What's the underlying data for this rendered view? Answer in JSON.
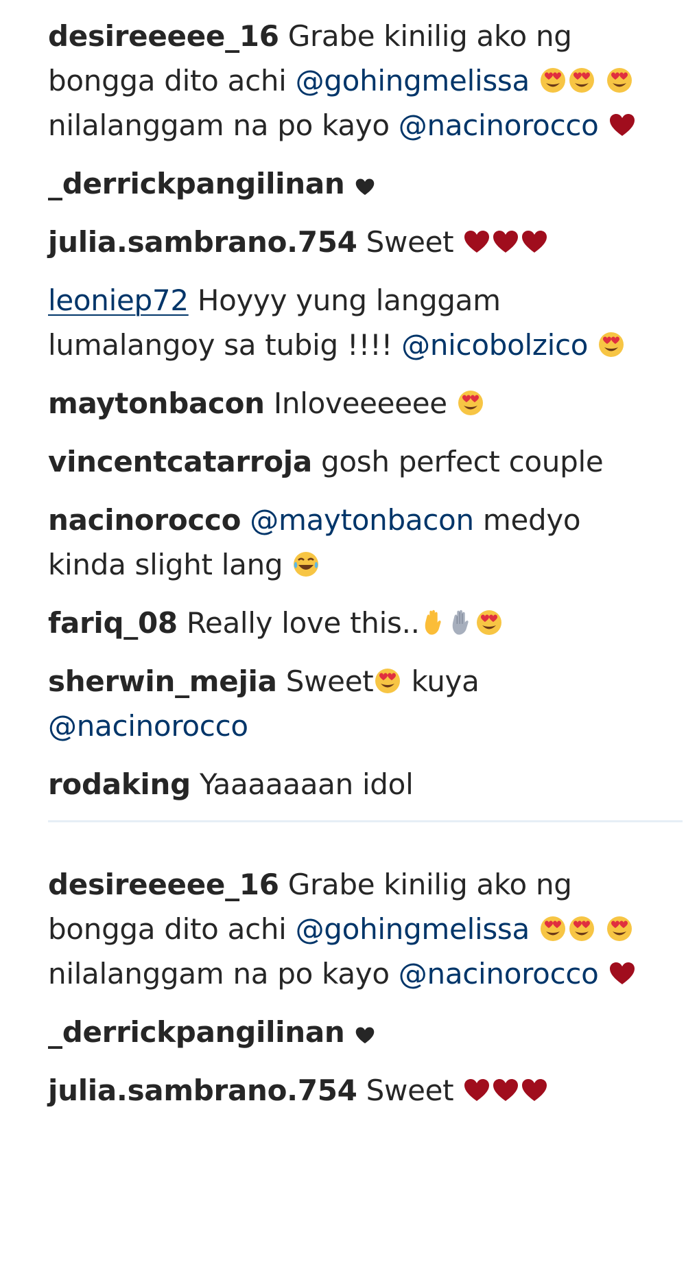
{
  "colors": {
    "username": "#262626",
    "text": "#262626",
    "mention": "#003569",
    "heart_red": "#a00d1d",
    "heart_black": "#262626",
    "emoji_face": "#f7c544",
    "emoji_heart_eyes": "#e02f3f",
    "divider": "#e6eef6"
  },
  "comments": [
    {
      "user": "desireeeee_16",
      "t1": "Grabe kinilig ako ng bongga dito achi",
      "m1": "@gohingmelissa",
      "t2": "nilalanggam na po kayo",
      "m2": "@nacinorocco",
      "emoji_names": [
        "heart-eyes-icon",
        "heart-eyes-icon",
        "heart-eyes-icon",
        "red-heart-icon"
      ]
    },
    {
      "user": "_derrickpangilinan",
      "emoji_names": [
        "black-heart-icon"
      ]
    },
    {
      "user": "julia.sambrano.754",
      "t1": "Sweet",
      "emoji_names": [
        "red-heart-icon",
        "red-heart-icon",
        "red-heart-icon"
      ]
    },
    {
      "user": "leoniep72",
      "t1": "Hoyyy yung langgam lumalangoy sa tubig !!!!",
      "m1": "@nicobolzico",
      "emoji_names": [
        "heart-eyes-icon"
      ]
    },
    {
      "user": "maytonbacon",
      "t1": "Inloveeeeee",
      "emoji_names": [
        "heart-eyes-icon"
      ]
    },
    {
      "user": "vincentcatarroja",
      "t1": "gosh perfect couple"
    },
    {
      "user": "nacinorocco",
      "m1": "@maytonbacon",
      "t1": "medyo kinda slight lang",
      "emoji_names": [
        "tears-of-joy-icon"
      ]
    },
    {
      "user": "fariq_08",
      "t1": "Really love this..",
      "emoji_names": [
        "raised-hand-icon",
        "grey-hand-icon",
        "heart-eyes-icon"
      ]
    },
    {
      "user": "sherwin_mejia",
      "t1": "Sweet",
      "t2": "kuya",
      "m1": "@nacinorocco",
      "emoji_names": [
        "heart-eyes-icon"
      ]
    },
    {
      "user": "rodaking",
      "t1": "Yaaaaaaan idol"
    },
    {
      "user": "desireeeee_16",
      "t1": "Grabe kinilig ako ng bongga dito achi",
      "m1": "@gohingmelissa",
      "t2": "nilalanggam na po kayo",
      "m2": "@nacinorocco",
      "emoji_names": [
        "heart-eyes-icon",
        "heart-eyes-icon",
        "heart-eyes-icon",
        "red-heart-icon"
      ]
    },
    {
      "user": "_derrickpangilinan",
      "emoji_names": [
        "black-heart-icon"
      ]
    },
    {
      "user": "julia.sambrano.754",
      "t1": "Sweet",
      "emoji_names": [
        "red-heart-icon",
        "red-heart-icon",
        "red-heart-icon"
      ]
    }
  ]
}
